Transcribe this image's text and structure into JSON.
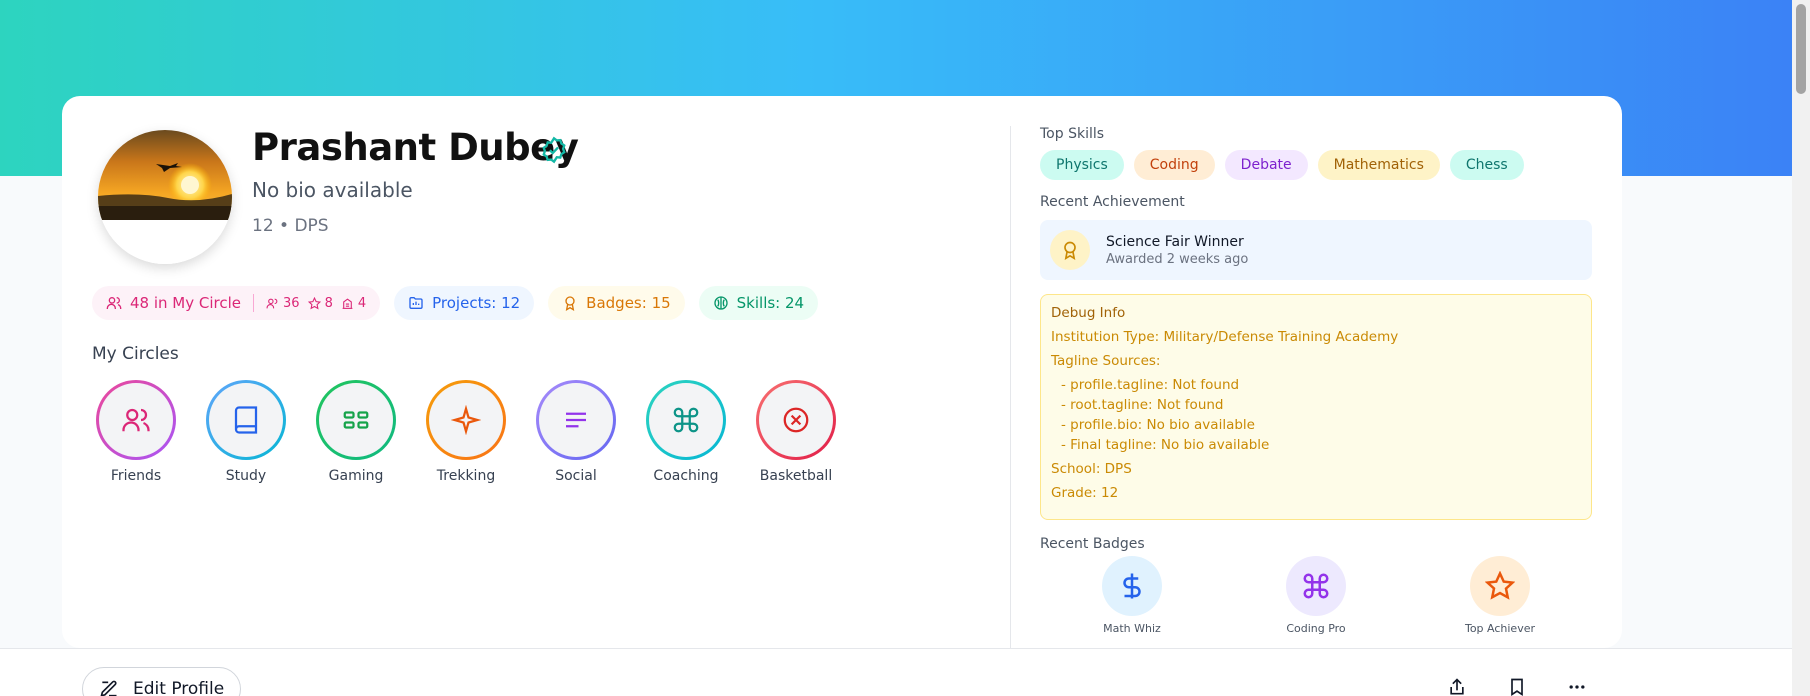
{
  "profile": {
    "name": "Prashant Dubey",
    "bio": "No bio available",
    "meta": "12 • DPS"
  },
  "stats": {
    "circle_label": "48 in My Circle",
    "friends": "36",
    "stars": "8",
    "groups": "4",
    "projects": "Projects: 12",
    "badges": "Badges: 15",
    "skills": "Skills: 24"
  },
  "circles": {
    "title": "My Circles",
    "items": [
      {
        "label": "Friends",
        "icon": "users-icon"
      },
      {
        "label": "Study",
        "icon": "book-icon"
      },
      {
        "label": "Gaming",
        "icon": "grid-icon"
      },
      {
        "label": "Trekking",
        "icon": "sparkle-icon"
      },
      {
        "label": "Social",
        "icon": "text-lines-icon"
      },
      {
        "label": "Coaching",
        "icon": "command-icon"
      },
      {
        "label": "Basketball",
        "icon": "circle-x-icon"
      }
    ]
  },
  "right": {
    "skills_title": "Top Skills",
    "skills": [
      "Physics",
      "Coding",
      "Debate",
      "Mathematics",
      "Chess"
    ],
    "achievement_title": "Recent Achievement",
    "achievement": {
      "title": "Science Fair Winner",
      "sub": "Awarded 2 weeks ago"
    },
    "debug": {
      "title": "Debug Info",
      "institution": "Institution Type: Military/Defense Training Academy",
      "tagline_sources": "Tagline Sources:",
      "items": [
        "- profile.tagline: Not found",
        "- root.tagline: Not found",
        "- profile.bio: No bio available",
        "- Final tagline: No bio available"
      ],
      "school": "School: DPS",
      "grade": "Grade: 12"
    },
    "badges_title": "Recent Badges",
    "badges": [
      {
        "label": "Math Whiz",
        "icon": "dollar-icon"
      },
      {
        "label": "Coding Pro",
        "icon": "command-icon"
      },
      {
        "label": "Top Achiever",
        "icon": "star-icon"
      }
    ]
  },
  "footer": {
    "edit_label": "Edit Profile"
  },
  "colors": {
    "gradient_start": "#2dd4bf",
    "gradient_end": "#3b82f6",
    "verified": "#14b8a6"
  }
}
